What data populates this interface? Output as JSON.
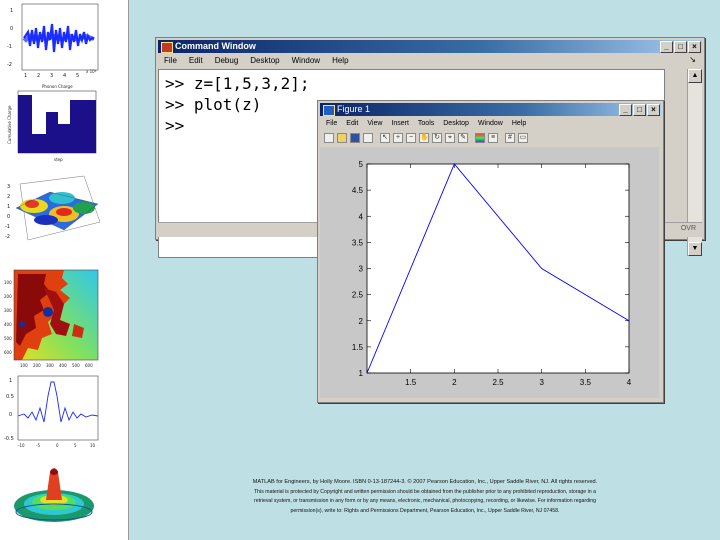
{
  "thumbnails": {
    "audio": {
      "y_ticks": [
        "1",
        "0",
        "-1",
        "-2"
      ],
      "x_ticks": [
        "1",
        "2",
        "3",
        "4",
        "5",
        "6"
      ],
      "x_exponent": "x 10⁴"
    },
    "histogram": {
      "title": "Phonon Charge",
      "y_label": "Cumulative Charge",
      "x_label": "step"
    },
    "surface": {
      "z_ticks": [
        "3",
        "2",
        "1",
        "0",
        "-1",
        "-2"
      ]
    },
    "fractal": {
      "y_ticks": [
        "100",
        "200",
        "300",
        "400",
        "500",
        "600"
      ],
      "x_ticks": [
        "100",
        "200",
        "300",
        "400",
        "500",
        "600"
      ]
    },
    "sinc": {
      "y_ticks": [
        "1",
        "0.5",
        "0",
        "-0.5"
      ],
      "x_ticks": [
        "-10",
        "-5",
        "0",
        "5",
        "10"
      ]
    }
  },
  "command_window": {
    "title": "Command Window",
    "menu": [
      "File",
      "Edit",
      "Debug",
      "Desktop",
      "Window",
      "Help"
    ],
    "lines": [
      ">> z=[1,5,3,2];",
      ">> plot(z)",
      ">>"
    ],
    "status": "OVR"
  },
  "figure_window": {
    "title": "Figure 1",
    "menu": [
      "File",
      "Edit",
      "View",
      "Insert",
      "Tools",
      "Desktop",
      "Window",
      "Help"
    ],
    "toolbar_icons": [
      "new-icon",
      "open-icon",
      "save-icon",
      "print-icon",
      "arrow-icon",
      "zoom-in-icon",
      "zoom-out-icon",
      "pan-icon",
      "rotate-icon",
      "data-cursor-icon",
      "brush-icon",
      "colorbar-icon",
      "legend-icon",
      "grid-icon",
      "plot-tools-icon"
    ]
  },
  "chart_data": {
    "type": "line",
    "x": [
      1,
      2,
      3,
      4
    ],
    "y": [
      1,
      5,
      3,
      2
    ],
    "xlim": [
      1,
      4
    ],
    "ylim": [
      1,
      5
    ],
    "x_ticks": [
      "1",
      "1.5",
      "2",
      "2.5",
      "3",
      "3.5",
      "4"
    ],
    "y_ticks": [
      "1",
      "1.5",
      "2",
      "2.5",
      "3",
      "3.5",
      "4",
      "4.5",
      "5"
    ],
    "line_color": "#0000ff",
    "grid": false
  },
  "copyright": {
    "line1": "MATLAB for Engineers, by Holly Moore. ISBN 0-13-187244-3. © 2007 Pearson Education, Inc., Upper Saddle River, NJ. All rights reserved.",
    "line2": "This material is protected by Copyright and written permission should be obtained from the publisher prior to any prohibited reproduction, storage in a",
    "line3": "retrieval system, or transmission in any form or by any means, electronic, mechanical, photocopying, recording, or likewise. For information regarding",
    "line4": "permission(s), write to: Rights and Permissions Department, Pearson Education, Inc., Upper Saddle River, NJ 07458."
  },
  "colors": {
    "slide_background": "#bedfe3",
    "titlebar_start": "#0a246a",
    "titlebar_end": "#a6caf0"
  }
}
